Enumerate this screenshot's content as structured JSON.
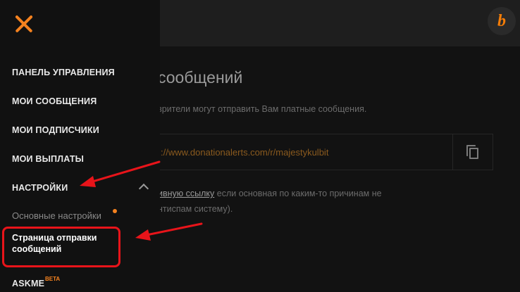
{
  "header": {
    "brand_letter": "b"
  },
  "main": {
    "title_fragment": "сообщений",
    "description": "зрители могут отправить Вам платные сообщения.",
    "link": "://www.donationalerts.com/r/majestykulbit",
    "note_link": "ивную ссылку",
    "note_rest": " если основная по каким-то причинам не",
    "note_line2": "нтиспам систему)."
  },
  "sidebar": {
    "items": [
      {
        "label": "ПАНЕЛЬ УПРАВЛЕНИЯ"
      },
      {
        "label": "МОИ СООБЩЕНИЯ"
      },
      {
        "label": "МОИ ПОДПИСЧИКИ"
      },
      {
        "label": "МОИ ВЫПЛАТЫ"
      },
      {
        "label": "НАСТРОЙКИ"
      }
    ],
    "sub_items": [
      {
        "label": "Основные настройки"
      },
      {
        "label": "Страница отправки сообщений"
      }
    ],
    "askme": "ASKME",
    "beta": "BETA"
  },
  "colors": {
    "accent": "#f5821f",
    "annotation": "#e8141a"
  }
}
